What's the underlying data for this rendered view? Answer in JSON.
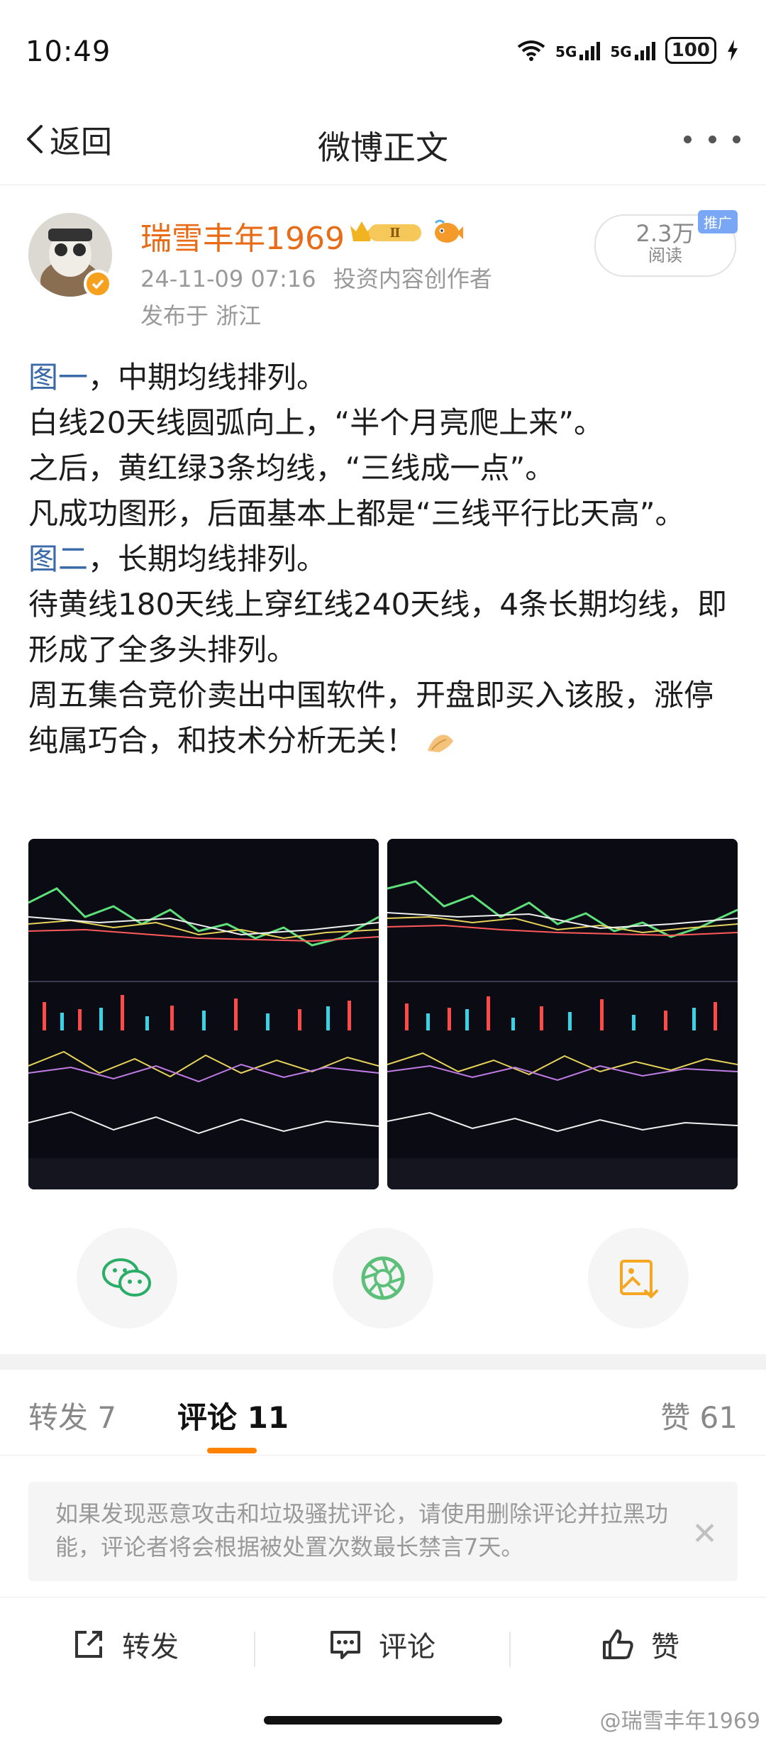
{
  "status": {
    "time": "10:49",
    "net1": "5G",
    "net2": "5G",
    "battery": "100"
  },
  "nav": {
    "back_label": "返回",
    "title": "微博正文"
  },
  "post": {
    "author": "瑞雪丰年1969",
    "timestamp": "24-11-09 07:16",
    "author_tag": "投资内容创作者",
    "location": "发布于 浙江",
    "reads_count": "2.3万",
    "reads_label": "阅读",
    "promo_tag": "推广",
    "body": {
      "fig1_label": "图一",
      "line1": "，中期均线排列。",
      "line2": "白线20天线圆弧向上，“半个月亮爬上来”。",
      "line3": "之后，黄红绿3条均线，“三线成一点”。",
      "line4": "凡成功图形，后面基本上都是“三线平行比天高”。",
      "fig2_label": "图二",
      "line5": "，长期均线排列。",
      "line6": "待黄线180天线上穿红线240天线，4条长期均线，即形成了全多头排列。",
      "line7": "周五集合竞价卖出中国软件，开盘即买入该股，涨停纯属巧合，和技术分析无关！"
    }
  },
  "share": {
    "icons": [
      "wechat-icon",
      "moments-icon",
      "save-image-icon"
    ]
  },
  "tabs": {
    "repost": "转发 7",
    "comments": "评论 11",
    "likes": "赞 61"
  },
  "notice": {
    "text": "如果发现恶意攻击和垃圾骚扰评论，请使用删除评论并拉黑功能，评论者将会根据被处置次数最长禁言7天。"
  },
  "actions": {
    "repost": "转发",
    "comment": "评论",
    "like": "赞"
  },
  "watermark": "@瑞雪丰年1969",
  "colors": {
    "accent": "#ff8200",
    "author": "#e86b17",
    "link": "#3b6aa8",
    "wechat": "#2aae67"
  }
}
